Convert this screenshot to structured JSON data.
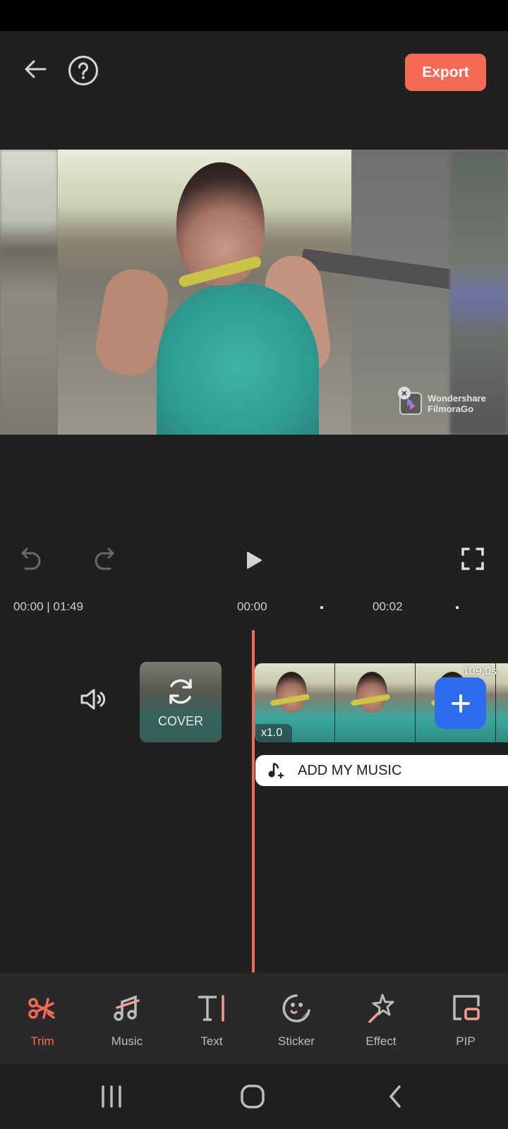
{
  "header": {
    "back_icon": "arrow-left-icon",
    "help_icon": "question-circle-icon",
    "export_label": "Export",
    "accent_color": "#f56a55"
  },
  "preview": {
    "watermark": {
      "line1": "Wondershare",
      "line2": "FilmoraGo",
      "close_glyph": "×"
    }
  },
  "playback": {
    "undo_icon": "undo-icon",
    "redo_icon": "redo-icon",
    "play_icon": "play-icon",
    "fullscreen_icon": "fullscreen-icon"
  },
  "timeline": {
    "current_total": "00:00 | 01:49",
    "ruler": [
      "00:00",
      "00:02"
    ],
    "cover_label": "COVER",
    "clip_speed": "x1.0",
    "clip_duration": "109.0s",
    "add_music_label": "ADD MY MUSIC"
  },
  "toolbar": {
    "items": [
      {
        "label": "Trim",
        "icon": "scissors-icon",
        "active": true
      },
      {
        "label": "Music",
        "icon": "music-note-icon",
        "active": false
      },
      {
        "label": "Text",
        "icon": "text-icon",
        "active": false
      },
      {
        "label": "Sticker",
        "icon": "sticker-icon",
        "active": false
      },
      {
        "label": "Effect",
        "icon": "magic-wand-icon",
        "active": false
      },
      {
        "label": "PIP",
        "icon": "pip-icon",
        "active": false
      }
    ]
  },
  "system_nav": {
    "recents_icon": "recents-icon",
    "home_icon": "home-icon",
    "back_icon": "nav-back-icon"
  }
}
